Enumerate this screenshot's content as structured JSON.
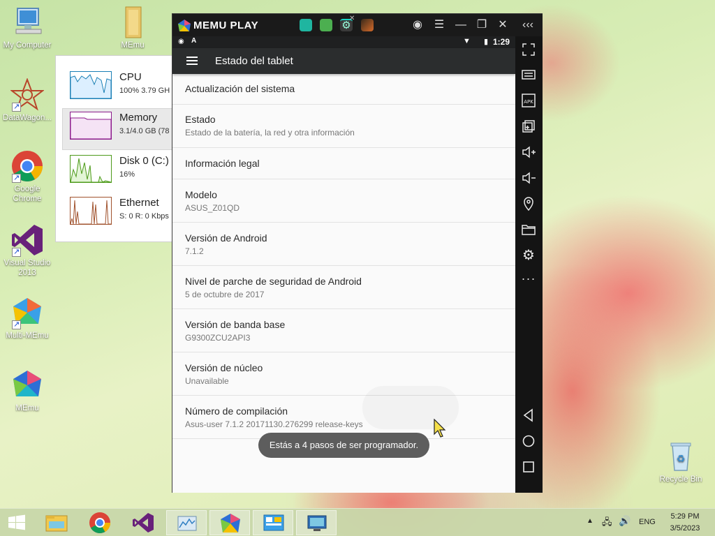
{
  "desktop": {
    "icons": [
      {
        "label": "My Computer"
      },
      {
        "label": "MEmu"
      },
      {
        "label": "DataWagon..."
      },
      {
        "label": "Google Chrome"
      },
      {
        "label": "Visual Studio 2013"
      },
      {
        "label": "Multi-MEmu"
      },
      {
        "label": "MEmu"
      },
      {
        "label": "Recycle Bin"
      }
    ]
  },
  "task_manager": {
    "items": [
      {
        "name": "CPU",
        "value": "100%  3.79 GH"
      },
      {
        "name": "Memory",
        "value": "3.1/4.0 GB (78"
      },
      {
        "name": "Disk 0 (C:)",
        "value": "16%"
      },
      {
        "name": "Ethernet",
        "value": "S: 0  R: 0 Kbps"
      }
    ]
  },
  "memu": {
    "brand": "MEMU PLAY",
    "status_time": "1:29",
    "app_title": "Estado del tablet",
    "rows": [
      {
        "title": "Actualización del sistema",
        "subtitle": ""
      },
      {
        "title": "Estado",
        "subtitle": "Estado de la batería, la red y otra información"
      },
      {
        "title": "Información legal",
        "subtitle": ""
      },
      {
        "title": "Modelo",
        "subtitle": "ASUS_Z01QD"
      },
      {
        "title": "Versión de Android",
        "subtitle": "7.1.2"
      },
      {
        "title": "Nivel de parche de seguridad de Android",
        "subtitle": "5 de octubre de 2017"
      },
      {
        "title": "Versión de banda base",
        "subtitle": "G9300ZCU2API3"
      },
      {
        "title": "Versión de núcleo",
        "subtitle": "Unavailable"
      },
      {
        "title": "Número de compilación",
        "subtitle": "Asus-user 7.1.2 20171130.276299 release-keys"
      }
    ],
    "toast": "Estás a 4 pasos de ser programador."
  },
  "taskbar": {
    "language": "ENG",
    "time": "5:29 PM",
    "date": "3/5/2023"
  },
  "colors": {
    "cpu": "#1a7fb5",
    "memory": "#8b1a8b",
    "disk": "#4d9a1a",
    "ethernet": "#a0522d"
  }
}
